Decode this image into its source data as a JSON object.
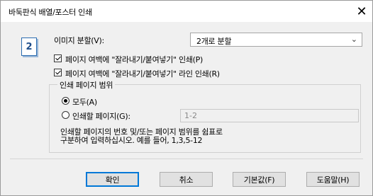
{
  "window": {
    "title": "바둑판식 배열/포스터 인쇄"
  },
  "image_split": {
    "label": "이미지 분할(V):",
    "selected": "2개로 분할"
  },
  "options": {
    "cut_paste_print": "페이지 여백에 \"잘라내기/붙여넣기\" 인쇄(P)",
    "cut_paste_line_print": "페이지 여백에 \"잘라내기/붙여넣기\" 라인 인쇄(R)"
  },
  "print_range": {
    "title": "인쇄 페이지 범위",
    "all_label": "모두(A)",
    "pages_label": "인쇄할 페이지(G):",
    "pages_value": "1-2",
    "help_line1": "인쇄할 페이지의 번호 및/또는 페이지 범위를 쉼표로",
    "help_line2": "구분하여 입력하십시오. 예를 들어, 1,3,5-12"
  },
  "buttons": {
    "ok": "확인",
    "cancel": "취소",
    "defaults": "기본값(F)",
    "help": "도움말(H)"
  },
  "icons": {
    "close": "close-icon",
    "page": "page-split-icon"
  }
}
